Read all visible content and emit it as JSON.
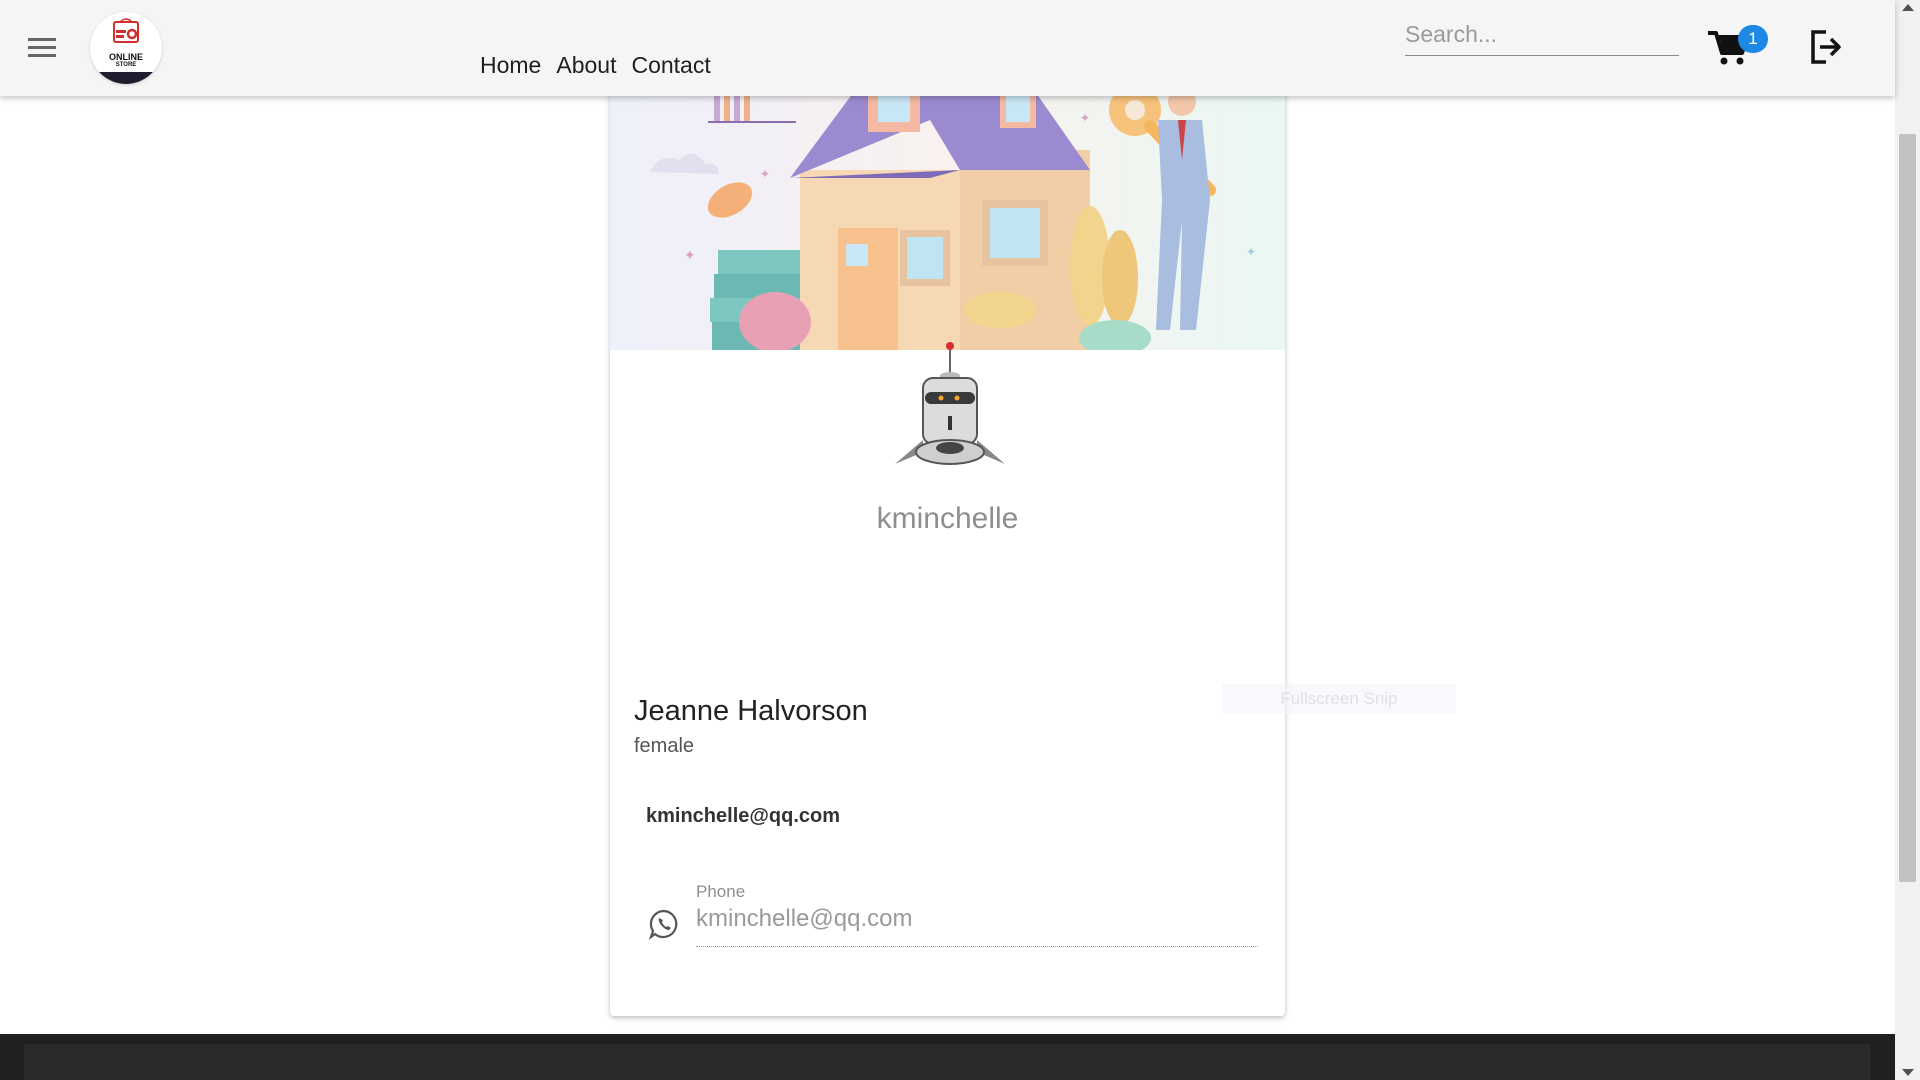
{
  "header": {
    "menu_icon": "hamburger-menu-icon",
    "logo": {
      "line1": "ONLINE",
      "line2": "STORE",
      "mark": "3 0"
    },
    "nav": [
      {
        "label": "Home"
      },
      {
        "label": "About"
      },
      {
        "label": "Contact"
      }
    ],
    "search": {
      "placeholder": "Search...",
      "value": ""
    },
    "cart": {
      "icon": "shopping-cart-icon",
      "count": "1"
    },
    "logout_icon": "logout-icon",
    "accent_color": "#1e88e5"
  },
  "profile": {
    "banner": "house-illustration",
    "avatar": "robot-avatar",
    "username": "kminchelle",
    "full_name": "Jeanne Halvorson",
    "gender": "female",
    "email": "kminchelle@qq.com",
    "phone": {
      "icon": "whatsapp-icon",
      "label": "Phone",
      "value": "kminchelle@qq.com"
    }
  },
  "overlay": {
    "snip_text": "Fullscreen Snip"
  }
}
